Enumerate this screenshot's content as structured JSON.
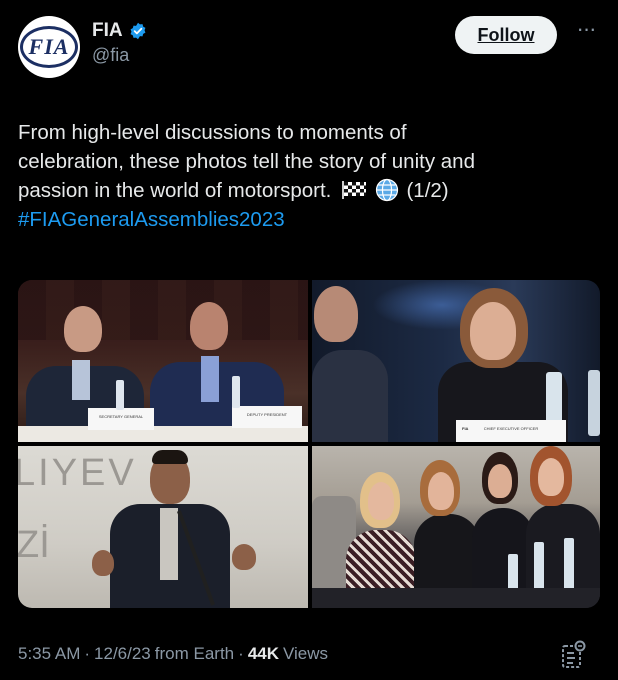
{
  "account": {
    "name": "FIA",
    "handle": "@fia",
    "avatar_text": "FIA",
    "verified_icon": "verified-badge-icon"
  },
  "follow_label": "Follow",
  "more_icon": "more-options-icon",
  "tweet": {
    "line1": "From high-level discussions to moments of",
    "line2": "celebration, these photos tell the story of unity and",
    "line3_text": "passion in the world of motorsport.",
    "line3_suffix": "(1/2)",
    "hashtag": "#FIAGeneralAssemblies2023",
    "emoji_1": "chequered-flag-icon",
    "emoji_2": "globe-icon"
  },
  "photos": {
    "p1": {
      "plate_left": "SECRETARY GENERAL",
      "plate_right": "DEPUTY PRESIDENT"
    },
    "p2": {
      "plate": "CHIEF EXECUTIVE OFFICER",
      "plate_logo": "FIA"
    },
    "p3": {
      "wall_line1": "LIYEV",
      "wall_line2": "Zİ"
    }
  },
  "meta": {
    "time": "5:35 AM",
    "date": "12/6/23",
    "source": "from Earth",
    "views_count": "44K",
    "views_label": "Views",
    "separator": "·"
  },
  "colors": {
    "background": "#000000",
    "hashtag": "#1d9bf0",
    "verified": "#1d9bf0",
    "muted": "#8b98a5"
  }
}
